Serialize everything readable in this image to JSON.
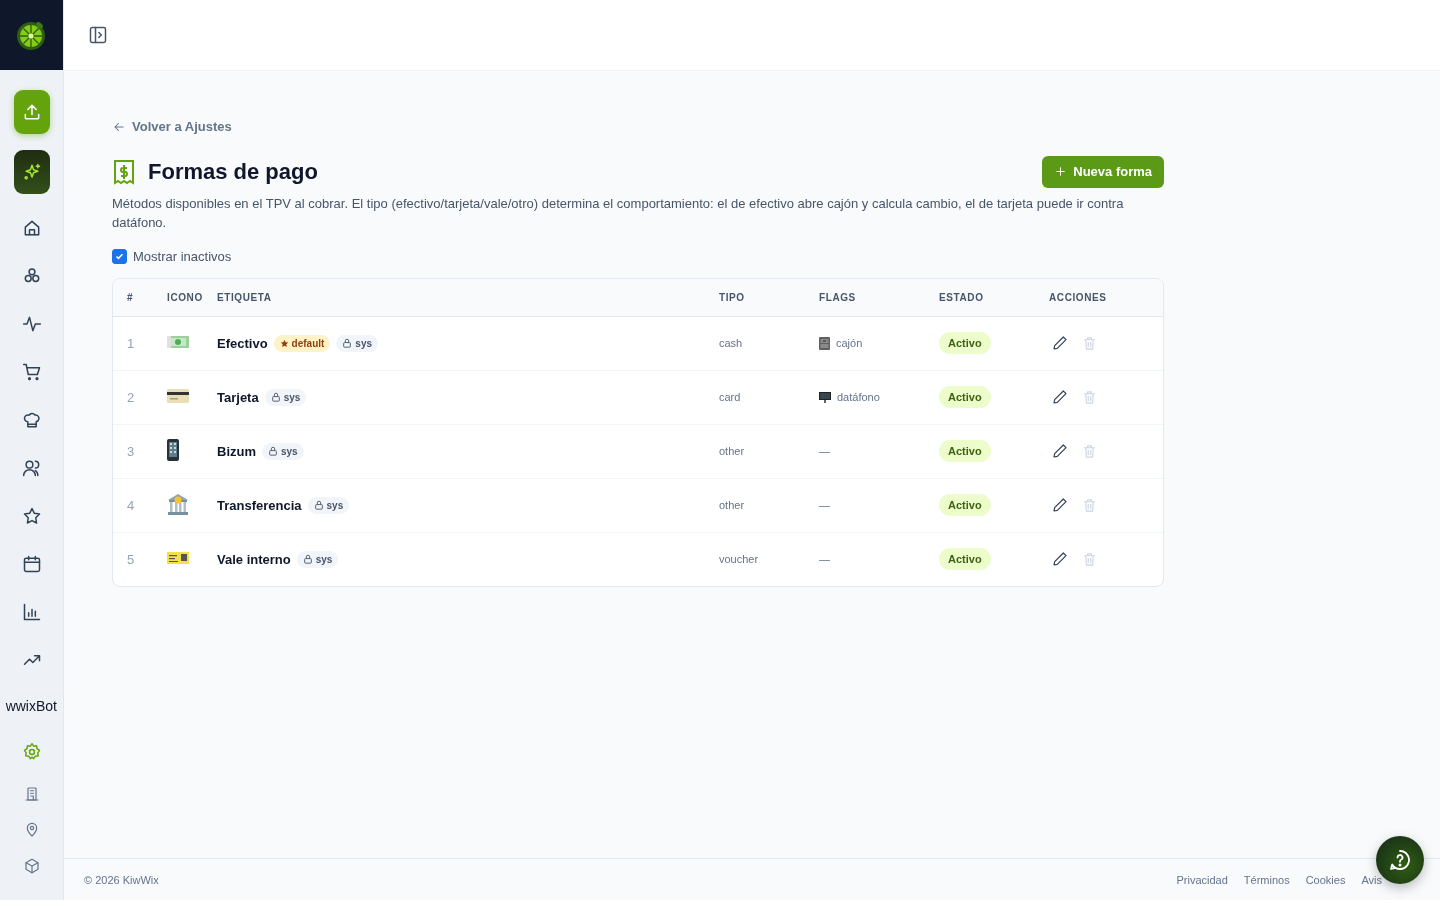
{
  "sidebar": {
    "nav_items": [
      {
        "kind": "upload"
      },
      {
        "kind": "assistant"
      },
      {
        "kind": "home",
        "selected": false
      },
      {
        "kind": "boxes",
        "selected": false
      },
      {
        "kind": "activity",
        "selected": false
      },
      {
        "kind": "cart",
        "selected": false
      },
      {
        "kind": "chef",
        "selected": false
      },
      {
        "kind": "users",
        "selected": false
      },
      {
        "kind": "star",
        "selected": false
      },
      {
        "kind": "calendar",
        "selected": false
      },
      {
        "kind": "bars",
        "selected": false
      },
      {
        "kind": "trend",
        "selected": false
      },
      {
        "kind": "label",
        "label": "wwixBot",
        "selected": false
      },
      {
        "kind": "settings",
        "selected": true
      },
      {
        "kind": "building",
        "selected": false
      },
      {
        "kind": "pin",
        "selected": false
      },
      {
        "kind": "package",
        "selected": false
      }
    ]
  },
  "page": {
    "back_link": "Volver a Ajustes",
    "title": "Formas de pago",
    "new_button": "Nueva forma",
    "description": "Métodos disponibles en el TPV al cobrar. El tipo (efectivo/tarjeta/vale/otro) determina el comportamiento: el de efectivo abre cajón y calcula cambio, el de tarjeta puede ir contra datáfono.",
    "show_inactive": {
      "label": "Mostrar inactivos",
      "checked": true
    }
  },
  "table": {
    "columns": [
      "#",
      "ICONO",
      "ETIQUETA",
      "TIPO",
      "FLAGS",
      "ESTADO",
      "ACCIONES"
    ],
    "rows": [
      {
        "number": "1",
        "kind": "banknote",
        "label": "Efectivo",
        "default_badge": "default",
        "system_badge": "sys",
        "type": "cash",
        "flag": {
          "kind": "drawer",
          "text": "cajón"
        },
        "status": "Activo",
        "active": true,
        "delete_disabled": true
      },
      {
        "number": "2",
        "kind": "creditcard",
        "label": "Tarjeta",
        "system_badge": "sys",
        "type": "card",
        "flag": {
          "kind": "terminal",
          "text": "datáfono"
        },
        "status": "Activo",
        "active": true,
        "delete_disabled": true
      },
      {
        "number": "3",
        "kind": "mobile",
        "label": "Bizum",
        "system_badge": "sys",
        "type": "other",
        "flag": {
          "kind": "none",
          "text": "—"
        },
        "status": "Activo",
        "active": true,
        "delete_disabled": true
      },
      {
        "number": "4",
        "kind": "bank",
        "label": "Transferencia",
        "system_badge": "sys",
        "type": "other",
        "flag": {
          "kind": "none",
          "text": "—"
        },
        "status": "Activo",
        "active": true,
        "delete_disabled": true
      },
      {
        "number": "5",
        "kind": "voucher",
        "label": "Vale interno",
        "system_badge": "sys",
        "type": "voucher",
        "flag": {
          "kind": "none",
          "text": "—"
        },
        "status": "Activo",
        "active": true,
        "delete_disabled": true
      }
    ]
  },
  "footer": {
    "copyright": "© 2026 KiwWix",
    "links": [
      "Privacidad",
      "Términos",
      "Cookies",
      "Avis"
    ]
  }
}
